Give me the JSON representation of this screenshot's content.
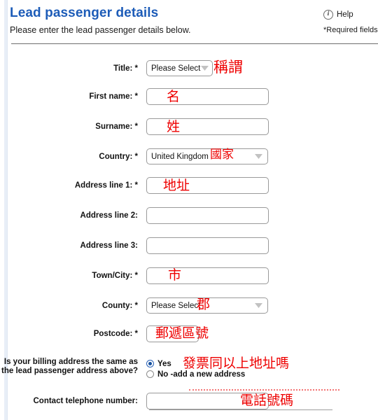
{
  "header": {
    "title": "Lead passenger details",
    "subtitle": "Please enter the lead passenger details below.",
    "help_label": "Help",
    "help_icon": "info-circle-icon",
    "required_note": "*Required fields",
    "title_color": "#1d5cb8"
  },
  "form": {
    "fields": [
      {
        "label": "Title: *",
        "type": "select",
        "value": "Please Select",
        "annotation": "稱謂"
      },
      {
        "label": "First name: *",
        "type": "text",
        "value": "",
        "annotation": "名"
      },
      {
        "label": "Surname: *",
        "type": "text",
        "value": "",
        "annotation": "姓"
      },
      {
        "label": "Country: *",
        "type": "select",
        "value": "United Kingdom",
        "annotation": "國家"
      },
      {
        "label": "Address line 1: *",
        "type": "text",
        "value": "",
        "annotation": "地址"
      },
      {
        "label": "Address line 2:",
        "type": "text",
        "value": "",
        "annotation": ""
      },
      {
        "label": "Address line 3:",
        "type": "text",
        "value": "",
        "annotation": ""
      },
      {
        "label": "Town/City: *",
        "type": "text",
        "value": "",
        "annotation": "市"
      },
      {
        "label": "County: *",
        "type": "select",
        "value": "Please Select",
        "annotation": "郡"
      },
      {
        "label": "Postcode: *",
        "type": "text",
        "value": "",
        "annotation": "郵遞區號"
      }
    ],
    "billing": {
      "label_line1": "Is your billing address the same as",
      "label_line2": "the lead passenger address above?",
      "options": [
        {
          "label": "Yes",
          "selected": true
        },
        {
          "label": "No -add a new address",
          "selected": false
        }
      ],
      "annotation": "發票同以上地址嗎"
    },
    "telephone": {
      "label": "Contact telephone number:",
      "value": "",
      "annotation": "電話號碼"
    }
  }
}
